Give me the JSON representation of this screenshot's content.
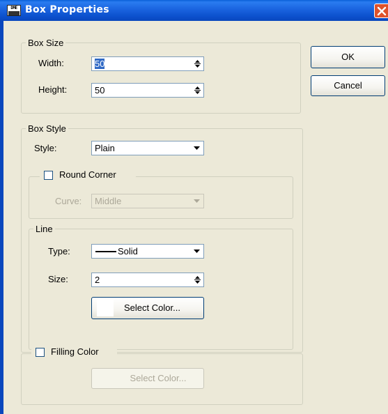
{
  "window": {
    "title": "Box Properties",
    "app_icon_text": "DME",
    "close_label": "×"
  },
  "box_size": {
    "group_label": "Box Size",
    "width_label": "Width:",
    "width_value": "50",
    "height_label": "Height:",
    "height_value": "50"
  },
  "buttons": {
    "ok": "OK",
    "cancel": "Cancel"
  },
  "box_style": {
    "group_label": "Box Style",
    "style_label": "Style:",
    "style_value": "Plain",
    "round_corner": {
      "label": "Round Corner",
      "checked": false,
      "curve_label": "Curve:",
      "curve_value": "Middle"
    },
    "line": {
      "group_label": "Line",
      "type_label": "Type:",
      "type_value": "Solid",
      "size_label": "Size:",
      "size_value": "2",
      "select_color_label": "Select Color...",
      "color": "#ffffff"
    }
  },
  "filling": {
    "label": "Filling Color",
    "checked": false,
    "select_color_label": "Select Color..."
  }
}
